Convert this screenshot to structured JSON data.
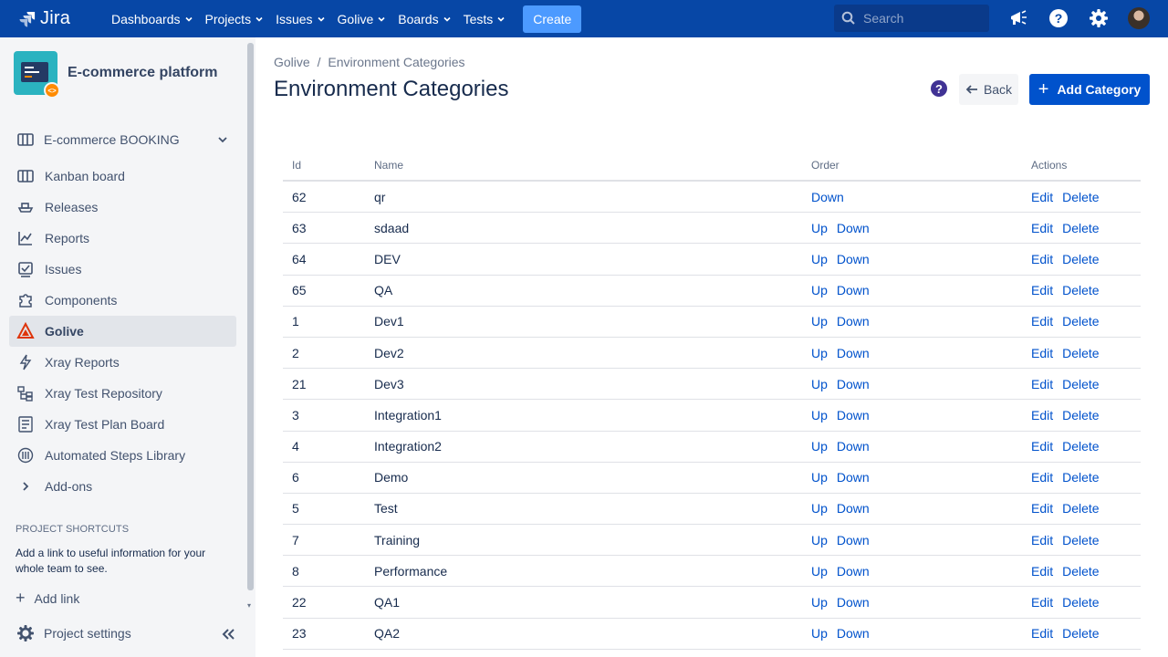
{
  "topnav": {
    "logo": "Jira",
    "menus": [
      "Dashboards",
      "Projects",
      "Issues",
      "Golive",
      "Boards",
      "Tests"
    ],
    "create_label": "Create",
    "search_placeholder": "Search",
    "icons": [
      "megaphone-icon",
      "help-icon",
      "settings-icon",
      "profile-avatar"
    ],
    "bar_color": "#0747a6"
  },
  "sidebar": {
    "project_name": "E-commerce platform",
    "board_selector": "E-commerce BOOKING",
    "items": [
      {
        "label": "Kanban board",
        "icon": "board-icon"
      },
      {
        "label": "Releases",
        "icon": "ship-icon"
      },
      {
        "label": "Reports",
        "icon": "chart-icon"
      },
      {
        "label": "Issues",
        "icon": "issues-icon"
      },
      {
        "label": "Components",
        "icon": "puzzle-icon"
      },
      {
        "label": "Golive",
        "icon": "golive-icon",
        "active": true
      },
      {
        "label": "Xray Reports",
        "icon": "bolt-icon"
      },
      {
        "label": "Xray Test Repository",
        "icon": "repository-icon"
      },
      {
        "label": "Xray Test Plan Board",
        "icon": "plan-board-icon"
      },
      {
        "label": "Automated Steps Library",
        "icon": "library-icon"
      },
      {
        "label": "Add-ons",
        "icon": "chevron-right-icon"
      }
    ],
    "shortcuts_title": "PROJECT SHORTCUTS",
    "shortcuts_desc": "Add a link to useful information for your whole team to see.",
    "add_link": "Add link",
    "project_settings": "Project settings"
  },
  "main": {
    "breadcrumb": {
      "parent": "Golive",
      "separator": "/",
      "current": "Environment Categories"
    },
    "title": "Environment Categories",
    "back_label": "Back",
    "add_label": "Add Category",
    "help_glyph": "?",
    "table": {
      "headers": [
        "Id",
        "Name",
        "Order",
        "Actions"
      ],
      "up_label": "Up",
      "down_label": "Down",
      "edit_label": "Edit",
      "delete_label": "Delete",
      "rows": [
        {
          "id": "62",
          "name": "qr",
          "up": false,
          "down": true
        },
        {
          "id": "63",
          "name": "sdaad",
          "up": true,
          "down": true
        },
        {
          "id": "64",
          "name": "DEV",
          "up": true,
          "down": true
        },
        {
          "id": "65",
          "name": "QA",
          "up": true,
          "down": true
        },
        {
          "id": "1",
          "name": "Dev1",
          "up": true,
          "down": true
        },
        {
          "id": "2",
          "name": "Dev2",
          "up": true,
          "down": true
        },
        {
          "id": "21",
          "name": "Dev3",
          "up": true,
          "down": true
        },
        {
          "id": "3",
          "name": "Integration1",
          "up": true,
          "down": true
        },
        {
          "id": "4",
          "name": "Integration2",
          "up": true,
          "down": true
        },
        {
          "id": "6",
          "name": "Demo",
          "up": true,
          "down": true
        },
        {
          "id": "5",
          "name": "Test",
          "up": true,
          "down": true
        },
        {
          "id": "7",
          "name": "Training",
          "up": true,
          "down": true
        },
        {
          "id": "8",
          "name": "Performance",
          "up": true,
          "down": true
        },
        {
          "id": "22",
          "name": "QA1",
          "up": true,
          "down": true
        },
        {
          "id": "23",
          "name": "QA2",
          "up": true,
          "down": true
        }
      ]
    }
  }
}
